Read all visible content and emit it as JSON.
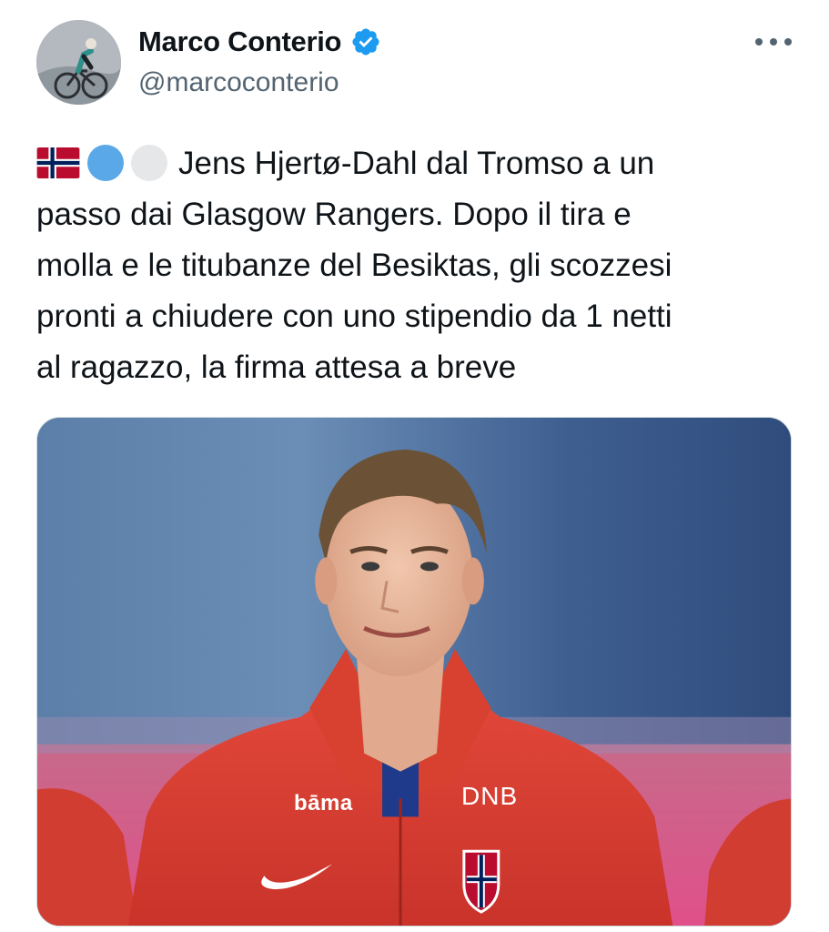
{
  "post": {
    "author": {
      "display_name": "Marco Conterio",
      "handle": "@marcoconterio",
      "verified": true
    },
    "more_icon": "more-horizontal-icon",
    "emoji": [
      "flag-norway",
      "blue-circle",
      "white-circle"
    ],
    "text_lines": [
      "Jens Hjertø-Dahl dal Tromso a un",
      "passo dai Glasgow Rangers. Dopo il tira e",
      "molla e le titubanze del Besiktas, gli scozzesi",
      "pronti a chiudere con uno stipendio da 1 netti",
      "al ragazzo, la firma attesa a breve"
    ],
    "media": {
      "jersey_sponsor_left": "bāma",
      "jersey_sponsor_right": "DNB"
    }
  },
  "colors": {
    "verified_badge": "#1d9bf0",
    "text_primary": "#0f1419",
    "text_secondary": "#536471",
    "jersey_red": "#d83a2c"
  }
}
